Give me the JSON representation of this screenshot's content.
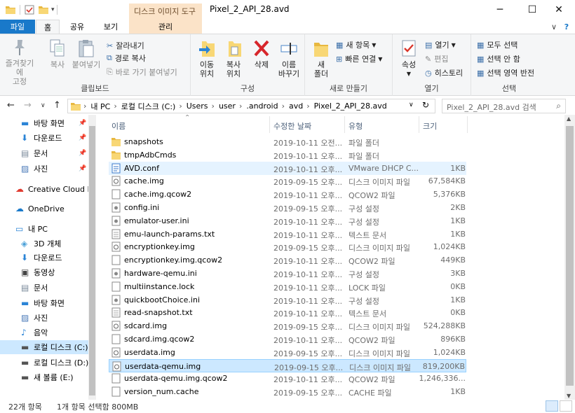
{
  "window": {
    "title": "Pixel_2_API_28.avd",
    "context_tab": "디스크 이미지 도구",
    "minimize": "─",
    "maximize": "☐",
    "close": "✕"
  },
  "ribbon_tabs": {
    "file": "파일",
    "home": "홈",
    "share": "공유",
    "view": "보기",
    "manage": "관리",
    "collapse": "∨",
    "help": "?"
  },
  "ribbon": {
    "clipboard": {
      "label": "클립보드",
      "pin_quick": "즐겨찾기에\n고정",
      "copy": "복사",
      "paste": "붙여넣기",
      "cut": "잘라내기",
      "copy_path": "경로 복사",
      "paste_shortcut": "바로 가기 붙여넣기"
    },
    "organize": {
      "label": "구성",
      "move_to": "이동\n위치",
      "copy_to": "복사\n위치",
      "delete": "삭제",
      "rename": "이름\n바꾸기"
    },
    "new": {
      "label": "새로 만들기",
      "new_folder": "새\n폴더",
      "new_item": "새 항목",
      "easy_access": "빠른 연결"
    },
    "open": {
      "label": "열기",
      "properties": "속성",
      "open": "열기",
      "edit": "편집",
      "history": "히스토리"
    },
    "select": {
      "label": "선택",
      "select_all": "모두 선택",
      "select_none": "선택 안 함",
      "invert": "선택 영역 반전"
    }
  },
  "address": {
    "segments": [
      "내 PC",
      "로컬 디스크 (C:)",
      "Users",
      "user",
      ".android",
      "avd",
      "Pixel_2_API_28.avd"
    ],
    "search_placeholder": "Pixel_2_API_28.avd 검색"
  },
  "nav": {
    "items": [
      {
        "label": "바탕 화면",
        "icon": "desktop-icon",
        "pinned": true
      },
      {
        "label": "다운로드",
        "icon": "download-icon",
        "pinned": true
      },
      {
        "label": "문서",
        "icon": "documents-icon",
        "pinned": true
      },
      {
        "label": "사진",
        "icon": "pictures-icon",
        "pinned": true
      },
      {
        "label": "Creative Cloud Fil",
        "icon": "creative-cloud-icon",
        "pinned": false
      },
      {
        "label": "OneDrive",
        "icon": "onedrive-icon",
        "pinned": false
      },
      {
        "label": "내 PC",
        "icon": "this-pc-icon",
        "pinned": false
      },
      {
        "label": "3D 개체",
        "icon": "3d-objects-icon",
        "pinned": false
      },
      {
        "label": "다운로드",
        "icon": "download-icon",
        "pinned": false
      },
      {
        "label": "동영상",
        "icon": "videos-icon",
        "pinned": false
      },
      {
        "label": "문서",
        "icon": "documents-icon",
        "pinned": false
      },
      {
        "label": "바탕 화면",
        "icon": "desktop-icon",
        "pinned": false
      },
      {
        "label": "사진",
        "icon": "pictures-icon",
        "pinned": false
      },
      {
        "label": "음악",
        "icon": "music-icon",
        "pinned": false
      },
      {
        "label": "로컬 디스크 (C:)",
        "icon": "drive-icon",
        "pinned": false
      },
      {
        "label": "로컬 디스크 (D:)",
        "icon": "drive-icon",
        "pinned": false
      },
      {
        "label": "새 볼륨 (E:)",
        "icon": "drive-icon",
        "pinned": false
      }
    ]
  },
  "columns": {
    "name": "이름",
    "date": "수정한 날짜",
    "type": "유형",
    "size": "크기"
  },
  "files": [
    {
      "name": "snapshots",
      "date": "2019-10-11 오전...",
      "type": "파일 폴더",
      "size": "",
      "icon": "folder-icon"
    },
    {
      "name": "tmpAdbCmds",
      "date": "2019-10-11 오후...",
      "type": "파일 폴더",
      "size": "",
      "icon": "folder-icon"
    },
    {
      "name": "AVD.conf",
      "date": "2019-10-11 오후...",
      "type": "VMware DHCP C...",
      "size": "1KB",
      "icon": "config-file-icon"
    },
    {
      "name": "cache.img",
      "date": "2019-09-15 오후...",
      "type": "디스크 이미지 파일",
      "size": "67,584KB",
      "icon": "disk-image-icon"
    },
    {
      "name": "cache.img.qcow2",
      "date": "2019-10-11 오후...",
      "type": "QCOW2 파일",
      "size": "5,376KB",
      "icon": "file-icon"
    },
    {
      "name": "config.ini",
      "date": "2019-09-15 오후...",
      "type": "구성 설정",
      "size": "2KB",
      "icon": "settings-file-icon"
    },
    {
      "name": "emulator-user.ini",
      "date": "2019-10-11 오후...",
      "type": "구성 설정",
      "size": "1KB",
      "icon": "settings-file-icon"
    },
    {
      "name": "emu-launch-params.txt",
      "date": "2019-10-11 오후...",
      "type": "텍스트 문서",
      "size": "1KB",
      "icon": "text-file-icon"
    },
    {
      "name": "encryptionkey.img",
      "date": "2019-09-15 오후...",
      "type": "디스크 이미지 파일",
      "size": "1,024KB",
      "icon": "disk-image-icon"
    },
    {
      "name": "encryptionkey.img.qcow2",
      "date": "2019-10-11 오후...",
      "type": "QCOW2 파일",
      "size": "449KB",
      "icon": "file-icon"
    },
    {
      "name": "hardware-qemu.ini",
      "date": "2019-10-11 오후...",
      "type": "구성 설정",
      "size": "3KB",
      "icon": "settings-file-icon"
    },
    {
      "name": "multiinstance.lock",
      "date": "2019-10-11 오후...",
      "type": "LOCK 파일",
      "size": "0KB",
      "icon": "file-icon"
    },
    {
      "name": "quickbootChoice.ini",
      "date": "2019-10-11 오후...",
      "type": "구성 설정",
      "size": "1KB",
      "icon": "settings-file-icon"
    },
    {
      "name": "read-snapshot.txt",
      "date": "2019-10-11 오후...",
      "type": "텍스트 문서",
      "size": "0KB",
      "icon": "text-file-icon"
    },
    {
      "name": "sdcard.img",
      "date": "2019-09-15 오후...",
      "type": "디스크 이미지 파일",
      "size": "524,288KB",
      "icon": "disk-image-icon"
    },
    {
      "name": "sdcard.img.qcow2",
      "date": "2019-10-11 오후...",
      "type": "QCOW2 파일",
      "size": "896KB",
      "icon": "file-icon"
    },
    {
      "name": "userdata.img",
      "date": "2019-09-15 오후...",
      "type": "디스크 이미지 파일",
      "size": "1,024KB",
      "icon": "disk-image-icon"
    },
    {
      "name": "userdata-qemu.img",
      "date": "2019-09-15 오후...",
      "type": "디스크 이미지 파일",
      "size": "819,200KB",
      "icon": "disk-image-icon"
    },
    {
      "name": "userdata-qemu.img.qcow2",
      "date": "2019-10-11 오후...",
      "type": "QCOW2 파일",
      "size": "1,246,336...",
      "icon": "file-icon"
    },
    {
      "name": "version_num.cache",
      "date": "2019-09-15 오후...",
      "type": "CACHE 파일",
      "size": "1KB",
      "icon": "file-icon"
    }
  ],
  "status": {
    "count": "22개 항목",
    "selection": "1개 항목 선택함 800MB"
  },
  "colors": {
    "accent": "#1979ca",
    "selection": "#cce8ff",
    "hover": "#e5f3ff",
    "context_tab": "#fbe3c8"
  }
}
